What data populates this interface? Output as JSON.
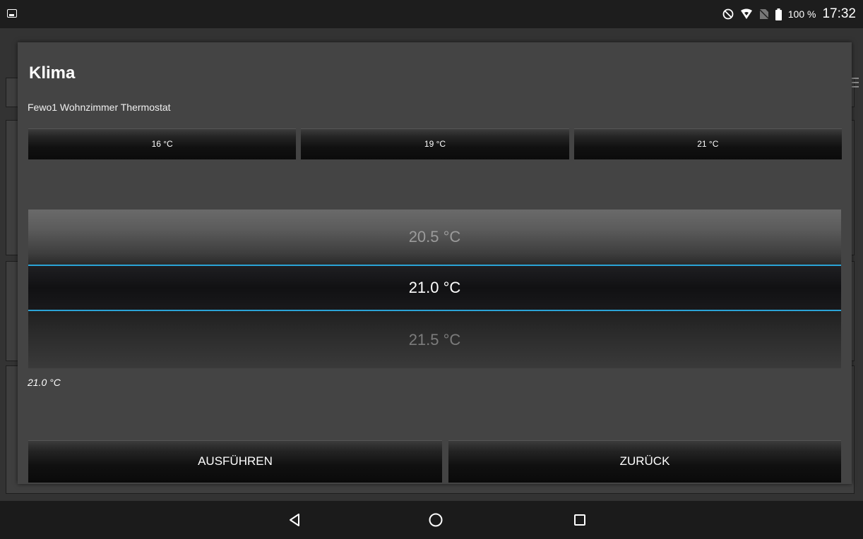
{
  "status_bar": {
    "battery_percent": "100 %",
    "time": "17:32",
    "icons": [
      "gallery-icon",
      "do-not-disturb-icon",
      "wifi-icon",
      "no-sim-icon",
      "battery-icon"
    ]
  },
  "dialog": {
    "title": "Klima",
    "subtitle": "Fewo1 Wohnzimmer Thermostat",
    "presets": [
      "16 °C",
      "19 °C",
      "21 °C"
    ],
    "picker": {
      "previous": "20.5 °C",
      "current": "21.0 °C",
      "next": "21.5 °C",
      "selection_color": "#2ba3d6"
    },
    "value_readout": "21.0 °C",
    "execute_label": "AUSFÜHREN",
    "back_label": "ZURÜCK"
  },
  "navigation_bar": {
    "icons": [
      "back-icon",
      "home-icon",
      "recents-icon"
    ]
  }
}
